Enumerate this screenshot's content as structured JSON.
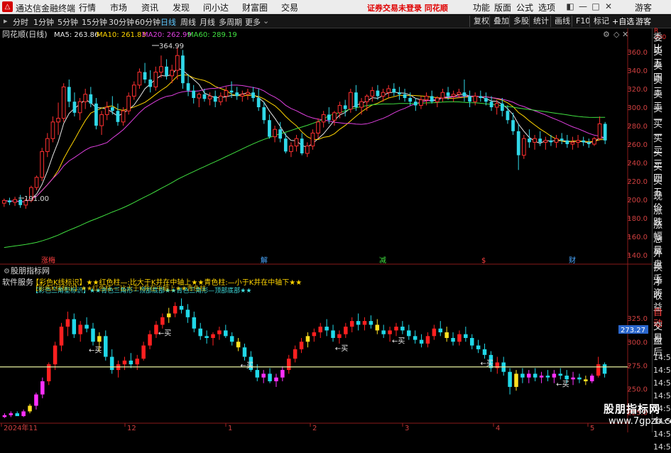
{
  "menubar": {
    "logo": "△",
    "app_name": "通达信金融终端",
    "items": [
      "行情",
      "市场",
      "资讯",
      "发现",
      "问小达",
      "财富圈",
      "交易"
    ],
    "notice": "证券交易未登录  同花顺",
    "right_items": [
      "功能",
      "版面",
      "公式",
      "选项"
    ],
    "guest": "游客",
    "window_controls": [
      "◧",
      "—",
      "□",
      "✕"
    ]
  },
  "toolbar": {
    "periods": [
      "分时",
      "1分钟",
      "5分钟",
      "15分钟",
      "30分钟",
      "60分钟",
      "日线",
      "周线",
      "月线",
      "多周期",
      "更多"
    ],
    "active_period": "日线",
    "more_arrow": "⌄",
    "right_buttons": [
      "复权",
      "叠加",
      "多股",
      "统计",
      "画线",
      "F10",
      "标记"
    ],
    "add_watch": "+自选",
    "guest": "游客"
  },
  "main_chart": {
    "stock_title": "同花顺(日线)",
    "ma_labels": [
      {
        "text": "MA5: 263.86",
        "color": "#e8e8e8"
      },
      {
        "text": "MA10: 261.83",
        "color": "#ffd400"
      },
      {
        "text": "MA20: 262.99",
        "color": "#e040e0"
      },
      {
        "text": "MA60: 289.19",
        "color": "#40e040"
      }
    ],
    "high_label": "364.99",
    "low_label": "191.00",
    "event_markers": [
      {
        "text": "涨梅",
        "color": "#ff4040"
      },
      {
        "text": "解",
        "color": "#4aa8ff"
      },
      {
        "text": "减",
        "color": "#40e040"
      },
      {
        "text": "$",
        "color": "#ff4040"
      },
      {
        "text": "财",
        "color": "#4aa8ff"
      }
    ]
  },
  "indicator": {
    "title": "股朋指标网",
    "service": "软件服务",
    "line1": "【彩色K线标识】★★红色柱—:比大于K并在中轴上★★青色柱:—小于K并在中轴下★★",
    "line2": "【彩色三角型标识】★★青色三角形—顶部底部★★青色三角形—顶部底部★★",
    "overlay": "【彩色K线标识】★★红色柱—:比大于K并在中轴上★★青色柱",
    "buy_label": "←买",
    "current_value": "273.27",
    "current_value_bg": "#2a66cc"
  },
  "x_axis": {
    "labels": [
      "2024年11",
      "12",
      "1",
      "2",
      "3",
      "4",
      "5"
    ]
  },
  "right_panel": {
    "header": "R 300",
    "items": [
      "委比",
      "卖五",
      "卖四",
      "卖三",
      "卖二",
      "卖一",
      "买一",
      "买二",
      "买三",
      "买四",
      "买五",
      "现价",
      "涨跌",
      "涨幅",
      "总量",
      "外盘",
      "换手",
      "净资",
      "收益",
      "自动",
      "交易",
      "盘后"
    ],
    "times": [
      "14:56",
      "14:56",
      "14:56",
      "14:56",
      "14:56",
      "14:56",
      "14:56",
      "14:56"
    ]
  },
  "watermark": {
    "line1": "股朋指标网",
    "line2": "www.7gpzb.com"
  },
  "chart_data": [
    {
      "type": "candlestick",
      "title": "同花顺(日线)",
      "ylim": [
        130,
        370
      ],
      "y_ticks": [
        140,
        160,
        180,
        200,
        220,
        240,
        260,
        280,
        300,
        320,
        340,
        360
      ],
      "x_labels": [
        "2024年11",
        "12",
        "1",
        "2",
        "3",
        "4",
        "5"
      ],
      "ohlc": [
        [
          196,
          201,
          192,
          199
        ],
        [
          199,
          202,
          194,
          197
        ],
        [
          197,
          203,
          193,
          200
        ],
        [
          200,
          205,
          191,
          194
        ],
        [
          194,
          201,
          190,
          199
        ],
        [
          199,
          215,
          197,
          213
        ],
        [
          213,
          226,
          210,
          224
        ],
        [
          224,
          256,
          220,
          252
        ],
        [
          252,
          272,
          246,
          266
        ],
        [
          266,
          290,
          262,
          284
        ],
        [
          284,
          305,
          270,
          288
        ],
        [
          288,
          326,
          284,
          322
        ],
        [
          322,
          330,
          300,
          306
        ],
        [
          306,
          316,
          290,
          294
        ],
        [
          294,
          310,
          286,
          306
        ],
        [
          306,
          320,
          298,
          314
        ],
        [
          314,
          322,
          300,
          304
        ],
        [
          304,
          310,
          276,
          280
        ],
        [
          280,
          296,
          270,
          292
        ],
        [
          292,
          306,
          286,
          300
        ],
        [
          300,
          312,
          292,
          296
        ],
        [
          296,
          304,
          280,
          284
        ],
        [
          284,
          300,
          280,
          296
        ],
        [
          296,
          316,
          292,
          312
        ],
        [
          312,
          328,
          308,
          324
        ],
        [
          324,
          342,
          320,
          338
        ],
        [
          338,
          348,
          326,
          330
        ],
        [
          330,
          340,
          316,
          322
        ],
        [
          322,
          344,
          318,
          338
        ],
        [
          338,
          356,
          332,
          344
        ],
        [
          344,
          352,
          330,
          334
        ],
        [
          334,
          346,
          326,
          340
        ],
        [
          340,
          365,
          330,
          356
        ],
        [
          356,
          362,
          320,
          326
        ],
        [
          326,
          336,
          312,
          318
        ],
        [
          318,
          324,
          304,
          310
        ],
        [
          310,
          316,
          300,
          314
        ],
        [
          314,
          320,
          306,
          309
        ],
        [
          309,
          316,
          302,
          312
        ],
        [
          312,
          318,
          300,
          306
        ],
        [
          306,
          316,
          302,
          312
        ],
        [
          312,
          322,
          306,
          318
        ],
        [
          318,
          328,
          310,
          316
        ],
        [
          316,
          322,
          308,
          312
        ],
        [
          312,
          318,
          306,
          314
        ],
        [
          314,
          320,
          308,
          316
        ],
        [
          316,
          322,
          306,
          310
        ],
        [
          310,
          320,
          296,
          300
        ],
        [
          300,
          306,
          282,
          286
        ],
        [
          286,
          292,
          266,
          268
        ],
        [
          268,
          280,
          262,
          276
        ],
        [
          276,
          284,
          262,
          266
        ],
        [
          266,
          272,
          250,
          252
        ],
        [
          252,
          262,
          246,
          258
        ],
        [
          258,
          270,
          252,
          266
        ],
        [
          266,
          272,
          248,
          250
        ],
        [
          250,
          262,
          246,
          258
        ],
        [
          258,
          276,
          254,
          272
        ],
        [
          272,
          288,
          266,
          284
        ],
        [
          284,
          296,
          278,
          292
        ],
        [
          292,
          300,
          282,
          286
        ],
        [
          286,
          296,
          280,
          294
        ],
        [
          294,
          306,
          288,
          302
        ],
        [
          302,
          308,
          290,
          298
        ],
        [
          298,
          320,
          294,
          316
        ],
        [
          316,
          324,
          296,
          300
        ],
        [
          300,
          310,
          292,
          306
        ],
        [
          306,
          314,
          296,
          312
        ],
        [
          312,
          322,
          306,
          318
        ],
        [
          318,
          324,
          308,
          312
        ],
        [
          312,
          320,
          306,
          316
        ],
        [
          316,
          324,
          310,
          320
        ],
        [
          320,
          326,
          312,
          316
        ],
        [
          316,
          322,
          308,
          314
        ],
        [
          314,
          320,
          306,
          310
        ],
        [
          310,
          316,
          302,
          306
        ],
        [
          306,
          310,
          296,
          302
        ],
        [
          302,
          312,
          298,
          308
        ],
        [
          308,
          316,
          302,
          312
        ],
        [
          312,
          318,
          304,
          306
        ],
        [
          306,
          312,
          300,
          310
        ],
        [
          310,
          320,
          306,
          316
        ],
        [
          316,
          322,
          308,
          312
        ],
        [
          312,
          318,
          306,
          314
        ],
        [
          314,
          320,
          310,
          316
        ],
        [
          316,
          330,
          306,
          312
        ],
        [
          312,
          318,
          300,
          306
        ],
        [
          306,
          316,
          302,
          312
        ],
        [
          312,
          318,
          306,
          310
        ],
        [
          310,
          316,
          302,
          306
        ],
        [
          306,
          312,
          296,
          300
        ],
        [
          300,
          308,
          292,
          304
        ],
        [
          304,
          310,
          290,
          296
        ],
        [
          296,
          302,
          282,
          286
        ],
        [
          286,
          294,
          270,
          274
        ],
        [
          274,
          282,
          232,
          248
        ],
        [
          248,
          270,
          244,
          266
        ],
        [
          266,
          276,
          256,
          262
        ],
        [
          262,
          270,
          254,
          266
        ],
        [
          266,
          274,
          258,
          262
        ],
        [
          262,
          268,
          254,
          264
        ],
        [
          264,
          270,
          258,
          262
        ],
        [
          262,
          270,
          256,
          266
        ],
        [
          266,
          272,
          260,
          264
        ],
        [
          264,
          270,
          256,
          260
        ],
        [
          260,
          268,
          254,
          262
        ],
        [
          262,
          270,
          256,
          264
        ],
        [
          264,
          268,
          258,
          262
        ],
        [
          262,
          266,
          256,
          260
        ],
        [
          260,
          268,
          258,
          266
        ],
        [
          266,
          290,
          264,
          282
        ],
        [
          282,
          284,
          260,
          264
        ]
      ]
    },
    {
      "type": "candlestick",
      "title": "股朋指标网",
      "ylim": [
        215,
        350
      ],
      "y_ticks": [
        225,
        250,
        275,
        300,
        325
      ],
      "current_value": 273.27,
      "ohlc": [
        [
          220,
          224,
          219,
          222
        ],
        [
          222,
          226,
          220,
          224
        ],
        [
          224,
          226,
          222,
          221
        ],
        [
          221,
          228,
          220,
          226
        ],
        [
          226,
          234,
          224,
          232
        ],
        [
          232,
          246,
          228,
          244
        ],
        [
          244,
          262,
          240,
          258
        ],
        [
          258,
          278,
          254,
          276
        ],
        [
          276,
          300,
          270,
          296
        ],
        [
          296,
          320,
          290,
          316
        ],
        [
          316,
          332,
          306,
          324
        ],
        [
          324,
          330,
          304,
          308
        ],
        [
          308,
          322,
          300,
          318
        ],
        [
          318,
          326,
          310,
          314
        ],
        [
          314,
          320,
          296,
          300
        ],
        [
          300,
          310,
          290,
          306
        ],
        [
          306,
          312,
          280,
          284
        ],
        [
          284,
          292,
          266,
          270
        ],
        [
          270,
          280,
          262,
          276
        ],
        [
          276,
          284,
          270,
          280
        ],
        [
          280,
          288,
          272,
          276
        ],
        [
          276,
          286,
          270,
          282
        ],
        [
          282,
          300,
          280,
          296
        ],
        [
          296,
          312,
          292,
          308
        ],
        [
          308,
          322,
          304,
          318
        ],
        [
          318,
          330,
          314,
          326
        ],
        [
          326,
          336,
          320,
          330
        ],
        [
          330,
          342,
          326,
          338
        ],
        [
          338,
          346,
          330,
          334
        ],
        [
          334,
          340,
          320,
          326
        ],
        [
          326,
          332,
          310,
          314
        ],
        [
          314,
          320,
          302,
          306
        ],
        [
          306,
          312,
          298,
          304
        ],
        [
          304,
          310,
          296,
          308
        ],
        [
          308,
          316,
          302,
          312
        ],
        [
          312,
          318,
          304,
          306
        ],
        [
          306,
          310,
          296,
          300
        ],
        [
          300,
          304,
          290,
          294
        ],
        [
          294,
          298,
          280,
          284
        ],
        [
          284,
          290,
          268,
          270
        ],
        [
          270,
          276,
          258,
          262
        ],
        [
          262,
          270,
          256,
          266
        ],
        [
          266,
          272,
          256,
          258
        ],
        [
          258,
          266,
          252,
          262
        ],
        [
          262,
          274,
          258,
          270
        ],
        [
          270,
          286,
          266,
          282
        ],
        [
          282,
          296,
          278,
          292
        ],
        [
          292,
          304,
          288,
          300
        ],
        [
          300,
          310,
          294,
          306
        ],
        [
          306,
          314,
          300,
          310
        ],
        [
          310,
          320,
          304,
          316
        ],
        [
          316,
          324,
          306,
          312
        ],
        [
          312,
          318,
          300,
          304
        ],
        [
          304,
          312,
          298,
          308
        ],
        [
          308,
          320,
          304,
          316
        ],
        [
          316,
          326,
          310,
          322
        ],
        [
          322,
          330,
          312,
          318
        ],
        [
          318,
          326,
          312,
          322
        ],
        [
          322,
          328,
          314,
          318
        ],
        [
          318,
          324,
          308,
          312
        ],
        [
          312,
          318,
          304,
          308
        ],
        [
          308,
          316,
          300,
          312
        ],
        [
          312,
          320,
          306,
          316
        ],
        [
          316,
          322,
          308,
          312
        ],
        [
          312,
          318,
          302,
          306
        ],
        [
          306,
          312,
          298,
          302
        ],
        [
          302,
          308,
          294,
          298
        ],
        [
          298,
          310,
          294,
          306
        ],
        [
          306,
          318,
          302,
          314
        ],
        [
          314,
          322,
          306,
          310
        ],
        [
          310,
          316,
          300,
          304
        ],
        [
          304,
          310,
          296,
          300
        ],
        [
          300,
          312,
          296,
          308
        ],
        [
          308,
          316,
          300,
          304
        ],
        [
          304,
          308,
          292,
          296
        ],
        [
          296,
          302,
          288,
          292
        ],
        [
          292,
          298,
          282,
          286
        ],
        [
          286,
          290,
          268,
          272
        ],
        [
          272,
          284,
          266,
          278
        ],
        [
          278,
          284,
          264,
          268
        ],
        [
          268,
          272,
          244,
          252
        ],
        [
          252,
          270,
          248,
          266
        ],
        [
          266,
          272,
          256,
          262
        ],
        [
          262,
          270,
          256,
          266
        ],
        [
          266,
          272,
          258,
          262
        ],
        [
          262,
          268,
          256,
          264
        ],
        [
          264,
          270,
          258,
          262
        ],
        [
          262,
          270,
          256,
          266
        ],
        [
          266,
          272,
          260,
          264
        ],
        [
          264,
          270,
          256,
          260
        ],
        [
          260,
          268,
          254,
          262
        ],
        [
          262,
          266,
          256,
          260
        ],
        [
          260,
          264,
          254,
          258
        ],
        [
          258,
          266,
          256,
          264
        ],
        [
          264,
          284,
          262,
          276
        ],
        [
          276,
          278,
          262,
          266
        ]
      ]
    }
  ]
}
